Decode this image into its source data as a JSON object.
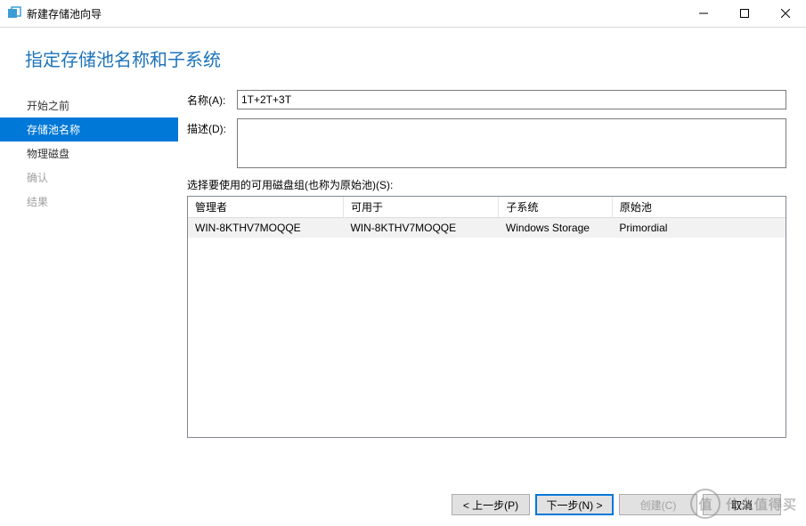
{
  "window": {
    "title": "新建存储池向导"
  },
  "header": {
    "title": "指定存储池名称和子系统"
  },
  "sidebar": {
    "steps": [
      {
        "label": "开始之前",
        "state": "done"
      },
      {
        "label": "存储池名称",
        "state": "active"
      },
      {
        "label": "物理磁盘",
        "state": "done"
      },
      {
        "label": "确认",
        "state": "todo"
      },
      {
        "label": "结果",
        "state": "todo"
      }
    ]
  },
  "form": {
    "name_label": "名称(A):",
    "name_value": "1T+2T+3T",
    "desc_label": "描述(D):",
    "desc_value": "",
    "disk_group_label": "选择要使用的可用磁盘组(也称为原始池)(S):"
  },
  "grid": {
    "columns": [
      {
        "label": "管理者",
        "width": "26%"
      },
      {
        "label": "可用于",
        "width": "26%"
      },
      {
        "label": "子系统",
        "width": "19%"
      },
      {
        "label": "原始池",
        "width": "29%"
      }
    ],
    "rows": [
      {
        "manager": "WIN-8KTHV7MOQQE",
        "available": "WIN-8KTHV7MOQQE",
        "subsystem": "Windows Storage",
        "pool": "Primordial",
        "selected": true
      }
    ]
  },
  "buttons": {
    "prev": "< 上一步(P)",
    "next": "下一步(N) >",
    "create": "创建(C)",
    "cancel": "取消"
  },
  "watermark": {
    "logo": "值",
    "text": "什么值得买"
  }
}
